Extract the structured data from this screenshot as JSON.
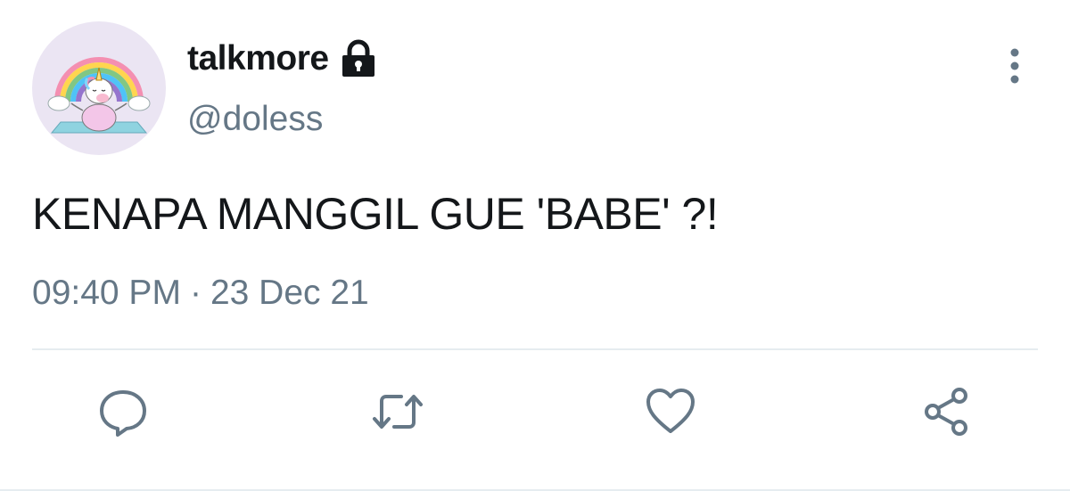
{
  "tweet": {
    "display_name": "talkmore",
    "protected": true,
    "handle": "@doless",
    "text": "KENAPA MANGGIL GUE 'BABE' ?!",
    "time": "09:40 PM",
    "separator": "·",
    "date": "23 Dec 21"
  },
  "avatar": {
    "description_icon": "unicorn-rainbow-avatar"
  },
  "icons": {
    "lock": "lock-icon",
    "more": "more-vertical-icon",
    "reply": "reply-icon",
    "retweet": "retweet-icon",
    "like": "heart-icon",
    "share": "share-icon"
  },
  "colors": {
    "text_primary": "#14171a",
    "text_secondary": "#657786",
    "avatar_bg": "#ebe5f3",
    "divider": "#e6ecf0"
  }
}
